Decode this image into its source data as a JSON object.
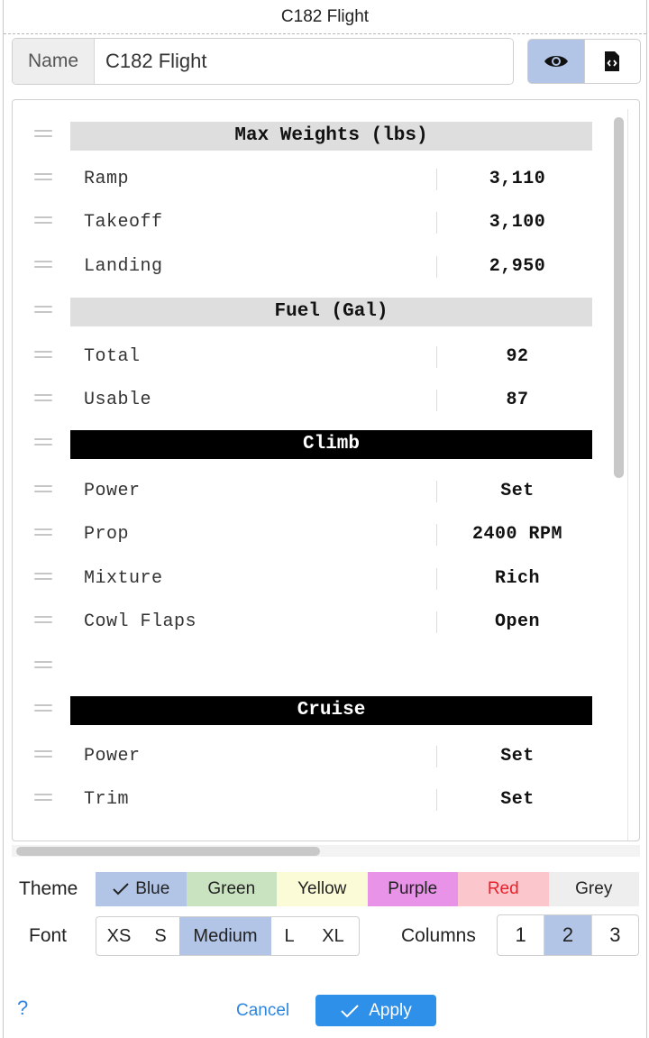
{
  "window": {
    "title": "C182 Flight"
  },
  "name_field": {
    "label": "Name",
    "value": "C182 Flight"
  },
  "view_toggle": [
    {
      "icon": "eye-icon",
      "active": true
    },
    {
      "icon": "code-file-icon",
      "active": false
    }
  ],
  "rows": [
    {
      "type": "header",
      "style": "grey",
      "text": "Max Weights (lbs)"
    },
    {
      "type": "item",
      "label": "Ramp",
      "value": "3,110"
    },
    {
      "type": "item",
      "label": "Takeoff",
      "value": "3,100"
    },
    {
      "type": "item",
      "label": "Landing",
      "value": "2,950"
    },
    {
      "type": "header",
      "style": "grey",
      "text": "Fuel (Gal)"
    },
    {
      "type": "item",
      "label": "Total",
      "value": "92"
    },
    {
      "type": "item",
      "label": "Usable",
      "value": "87"
    },
    {
      "type": "header",
      "style": "black",
      "text": "Climb"
    },
    {
      "type": "item",
      "label": "Power",
      "value": "Set"
    },
    {
      "type": "item",
      "label": "Prop",
      "value": "2400 RPM"
    },
    {
      "type": "item",
      "label": "Mixture",
      "value": "Rich"
    },
    {
      "type": "item",
      "label": "Cowl Flaps",
      "value": "Open"
    },
    {
      "type": "blank"
    },
    {
      "type": "header",
      "style": "black",
      "text": "Cruise"
    },
    {
      "type": "item",
      "label": "Power",
      "value": "Set"
    },
    {
      "type": "item",
      "label": "Trim",
      "value": "Set"
    }
  ],
  "theme": {
    "label": "Theme",
    "options": [
      {
        "name": "Blue",
        "bg": "#b2c5e6",
        "color": "#222222",
        "selected": true
      },
      {
        "name": "Green",
        "bg": "#c9e2c0",
        "color": "#222222",
        "selected": false
      },
      {
        "name": "Yellow",
        "bg": "#fbfbd8",
        "color": "#222222",
        "selected": false
      },
      {
        "name": "Purple",
        "bg": "#e893e8",
        "color": "#222222",
        "selected": false
      },
      {
        "name": "Red",
        "bg": "#fbc6cc",
        "color": "#e8222c",
        "selected": false
      },
      {
        "name": "Grey",
        "bg": "#eeeeee",
        "color": "#222222",
        "selected": false
      }
    ]
  },
  "font": {
    "label": "Font",
    "options": [
      "XS",
      "S",
      "Medium",
      "L",
      "XL"
    ],
    "selected": "Medium"
  },
  "columns": {
    "label": "Columns",
    "options": [
      "1",
      "2",
      "3"
    ],
    "selected": "2"
  },
  "footer": {
    "help": "?",
    "cancel": "Cancel",
    "apply": "Apply"
  },
  "colors": {
    "accent": "#2e90e8",
    "selection": "#b2c5e6"
  }
}
